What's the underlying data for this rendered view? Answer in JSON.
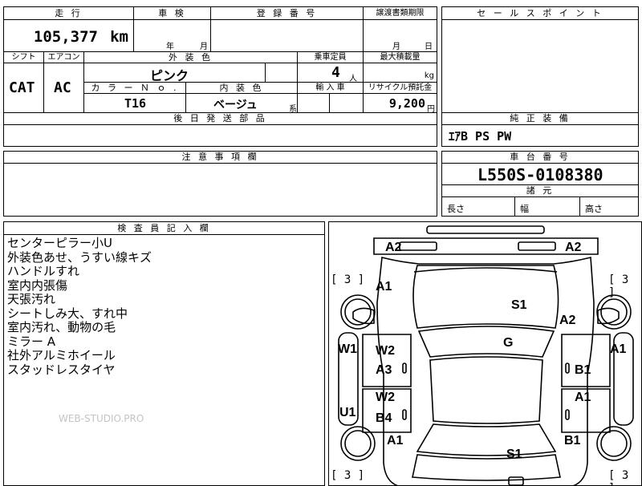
{
  "headers": {
    "mileage": "走 行",
    "inspection": "車 検",
    "registration": "登 録 番 号",
    "transfer_deadline": "譲渡書類期限",
    "sales_point": "セ ー ル ス ポ イ ン ト",
    "shift": "シフト",
    "aircon": "エアコン",
    "exterior_color": "外 装 色",
    "capacity": "乗車定員",
    "max_load": "最大積載量",
    "color_no": "カ ラ ー Ｎ ｏ .",
    "interior_color": "内 装 色",
    "import": "輸 入 車",
    "recycle": "リサイクル預託金",
    "later_parts": "後 日 発 送 部 品",
    "genuine_equipment": "純 正 装 備",
    "notes": "注 意 事 項 欄",
    "chassis_number": "車 台 番 号",
    "dimensions": "諸 元",
    "inspector_notes": "検 査 員 記 入 欄"
  },
  "values": {
    "mileage": "105,377",
    "mileage_unit": "km",
    "inspection_year": "年",
    "inspection_month": "月",
    "deadline_month": "月",
    "deadline_day": "日",
    "shift": "CAT",
    "aircon": "AC",
    "exterior_color": "ピンク",
    "capacity": "4",
    "capacity_unit": "人",
    "load_unit": "kg",
    "color_no": "T16",
    "interior_color": "ベージュ",
    "interior_suffix": "系",
    "recycle": "9,200",
    "recycle_unit": "円",
    "genuine_equipment": "ｴｱB PS PW",
    "chassis_number": "L550S-0108380",
    "length_label": "長さ",
    "width_label": "幅",
    "height_label": "高さ"
  },
  "remarks": [
    "センターピラー小U",
    "外装色あせ、うすい線キズ",
    "ハンドルすれ",
    "室内内張傷",
    "天張汚れ",
    "シートしみ大、すれ中",
    "室内汚れ、動物の毛",
    "ミラー A",
    "社外アルミホイール",
    "スタッドレスタイヤ"
  ],
  "watermark": "WEB-STUDIO.PRO",
  "damage_marks": {
    "front_left": "A2",
    "front_right": "A2",
    "bracket_tl": "[ 3 ]",
    "bracket_tr": "[ 3 ]",
    "bracket_bl": "[ 3 ]",
    "bracket_br": "[ 3 ]",
    "fender_fl": "A1",
    "hood": "S1",
    "fender_fr": "A2",
    "left_side": "W1",
    "roof": "G",
    "right_side": "A1",
    "door_l1_top": "W2",
    "door_l1_bottom": "A3",
    "door_r1": "B1",
    "door_l2_top": "W2",
    "door_l2_bottom": "B4",
    "door_r2": "A1",
    "left_rocker": "U1",
    "rear_fender_l": "A1",
    "rear_fender_r": "B1",
    "trunk": "S1"
  }
}
